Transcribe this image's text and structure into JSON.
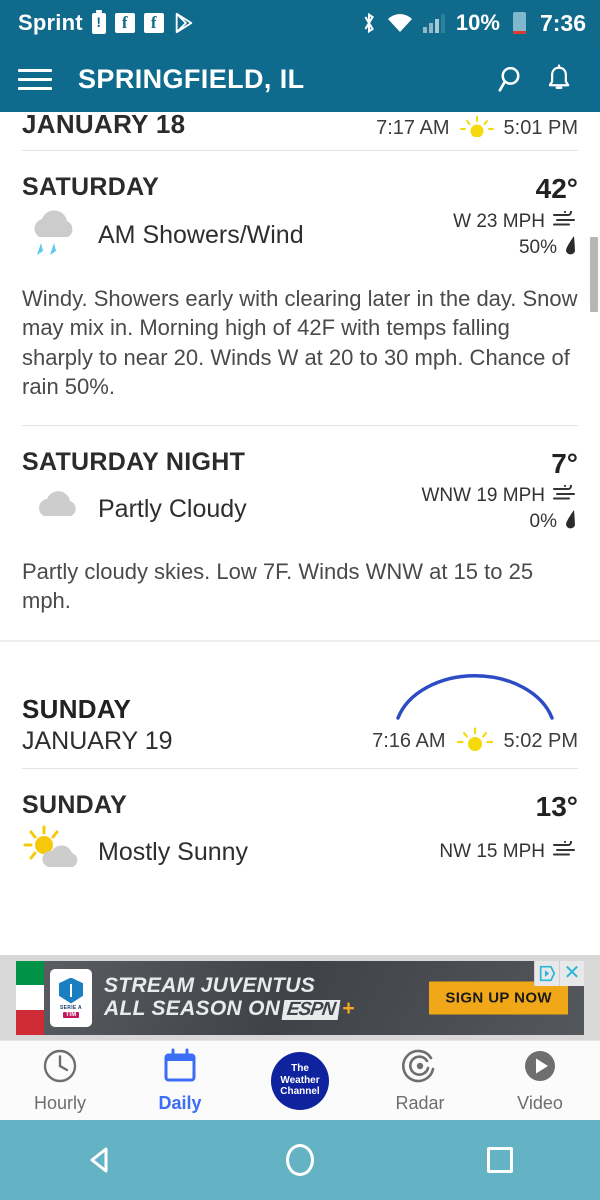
{
  "status_bar": {
    "carrier": "Sprint",
    "battery_percent": "10%",
    "time": "7:36",
    "icons": [
      "battery-alert-icon",
      "facebook-icon",
      "facebook-icon",
      "play-store-icon",
      "bluetooth-icon",
      "wifi-icon",
      "cell-signal-icon",
      "battery-icon"
    ]
  },
  "app_bar": {
    "title": "SPRINGFIELD, IL",
    "menu_icon": "hamburger-menu-icon",
    "search_icon": "search-icon",
    "alerts_icon": "bell-icon"
  },
  "partial_day_header": {
    "date": "JANUARY 18",
    "sunrise": "7:17 AM",
    "sunset": "5:01 PM",
    "sun_icon": "sunrise-sunset-icon"
  },
  "forecasts": [
    {
      "day": "SATURDAY",
      "temp": "42°",
      "condition": "AM Showers/Wind",
      "condition_icon": "rain-cloud-icon",
      "wind": "W 23 MPH",
      "precip": "50%",
      "description": "Windy. Showers early with clearing later in the day. Snow may mix in. Morning high of 42F with temps falling sharply to near 20. Winds W at 20 to 30 mph. Chance of rain 50%."
    },
    {
      "day": "SATURDAY NIGHT",
      "temp": "7°",
      "condition": "Partly Cloudy",
      "condition_icon": "partly-cloudy-night-icon",
      "wind": "WNW 19 MPH",
      "precip": "0%",
      "description": "Partly cloudy skies. Low 7F. Winds WNW at 15 to 25 mph."
    }
  ],
  "sunday_header": {
    "day": "SUNDAY",
    "date": "JANUARY 19",
    "sunrise": "7:16 AM",
    "sunset": "5:02 PM",
    "sun_icon": "sunrise-sunset-icon",
    "arc_icon": "daylight-arc-icon",
    "arc_color": "#2c4bc4"
  },
  "sunday_forecast": {
    "day": "SUNDAY",
    "temp": "13°",
    "condition": "Mostly Sunny",
    "condition_icon": "mostly-sunny-icon",
    "wind": "NW 15 MPH"
  },
  "ad": {
    "line1": "STREAM JUVENTUS",
    "line2": "ALL SEASON ON",
    "brand": "ESPN",
    "brand_plus": "+",
    "cta": "SIGN UP NOW",
    "badge_serie": "SERIE A",
    "badge_tim": "TIM",
    "choices_icon": "adchoices-icon",
    "close_icon": "close-icon"
  },
  "bottom_nav": {
    "items": [
      {
        "label": "Hourly",
        "icon": "clock-icon",
        "active": false
      },
      {
        "label": "Daily",
        "icon": "calendar-icon",
        "active": true
      },
      {
        "label": "",
        "icon": "weather-channel-logo",
        "active": false
      },
      {
        "label": "Radar",
        "icon": "radar-icon",
        "active": false
      },
      {
        "label": "Video",
        "icon": "play-icon",
        "active": false
      }
    ],
    "logo_lines": [
      "The",
      "Weather",
      "Channel"
    ],
    "active_color": "#3b6ef5"
  },
  "android_nav": {
    "back_icon": "back-triangle-icon",
    "home_icon": "home-circle-icon",
    "recents_icon": "recents-square-icon"
  },
  "theme": {
    "header_color": "#0f6b8d",
    "status_color": "#106a8c",
    "nav_bg": "#63b3c4"
  }
}
